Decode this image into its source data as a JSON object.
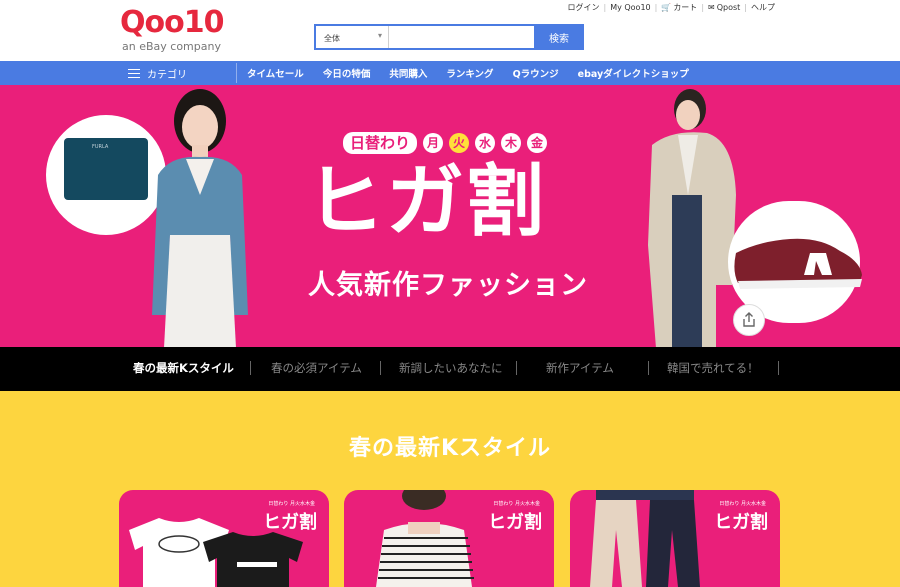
{
  "header": {
    "logo": "Qoo10",
    "logo_sub": "an eBay company",
    "util_links": [
      "ログイン",
      "My Qoo10",
      "カート",
      "Qpost",
      "ヘルプ"
    ],
    "search": {
      "category": "全体",
      "placeholder": "",
      "button": "検索"
    }
  },
  "nav": {
    "category_label": "カテゴリ",
    "links": [
      "タイムセール",
      "今日の特価",
      "共同購入",
      "ランキング",
      "Qラウンジ",
      "ebayダイレクトショップ"
    ]
  },
  "banner": {
    "day_label": "日替わり",
    "days": [
      "月",
      "火",
      "水",
      "木",
      "金"
    ],
    "active_day": "火",
    "title": "ヒガ割",
    "subtitle": "人気新作ファッション",
    "wallet_brand": "FURLA"
  },
  "category_strip": {
    "items": [
      "春の最新Kスタイル",
      "春の必須アイテム",
      "新調したいあなたに",
      "新作アイテム",
      "韓国で売れてる！"
    ],
    "active_index": 0
  },
  "section": {
    "title": "春の最新Kスタイル",
    "cards": [
      {
        "badge": "ヒガ割",
        "tag": "日替わり 月火水木金"
      },
      {
        "badge": "ヒガ割",
        "tag": "日替わり 月火水木金"
      },
      {
        "badge": "ヒガ割",
        "tag": "日替わり 月火水木金"
      }
    ]
  },
  "colors": {
    "brand_red": "#e6283e",
    "nav_blue": "#4a7be2",
    "banner_pink": "#ea1f7a",
    "section_yellow": "#fdd53f"
  }
}
